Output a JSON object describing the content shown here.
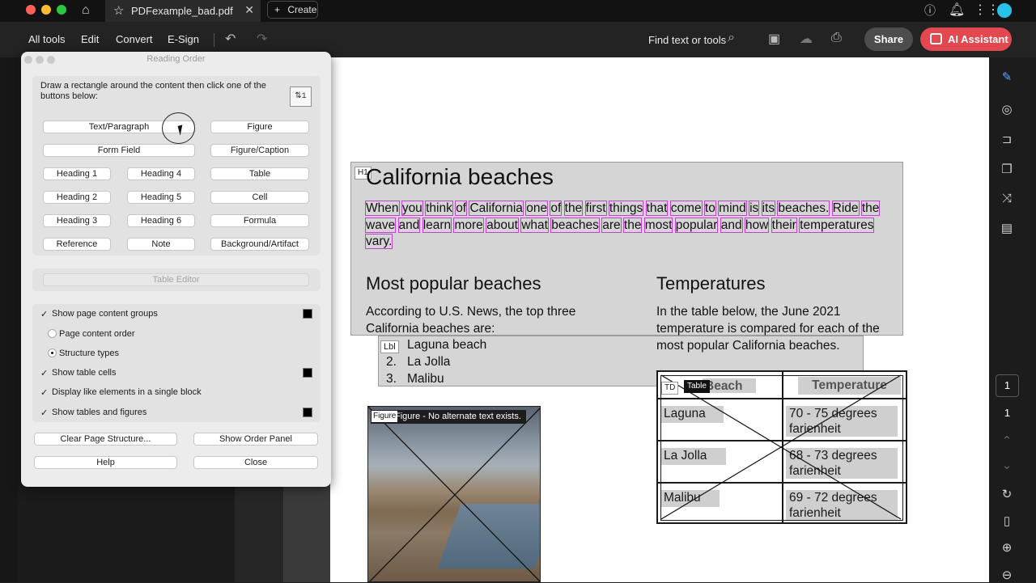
{
  "titlebar": {
    "tab_label": "PDFexample_bad.pdf",
    "create_label": "Create"
  },
  "toolbar": {
    "menus": [
      "All tools",
      "Edit",
      "Convert",
      "E-Sign"
    ],
    "find_label": "Find text or tools",
    "share_label": "Share",
    "ai_label": "AI Assistant"
  },
  "dialog": {
    "title": "Reading Order",
    "instructions": "Draw a rectangle around the content then click one of the buttons below:",
    "buttons": {
      "text_paragraph": "Text/Paragraph",
      "figure": "Figure",
      "form_field": "Form Field",
      "figure_caption": "Figure/Caption",
      "heading1": "Heading 1",
      "heading4": "Heading 4",
      "table": "Table",
      "heading2": "Heading 2",
      "heading5": "Heading 5",
      "cell": "Cell",
      "heading3": "Heading 3",
      "heading6": "Heading 6",
      "formula": "Formula",
      "reference": "Reference",
      "note": "Note",
      "background_artifact": "Background/Artifact",
      "table_editor": "Table Editor",
      "clear_structure": "Clear Page Structure...",
      "show_order_panel": "Show Order Panel",
      "help": "Help",
      "close": "Close"
    },
    "options": {
      "show_groups": "Show page content groups",
      "page_order": "Page content order",
      "structure_types": "Structure types",
      "show_cells": "Show table cells",
      "single_block": "Display like elements in a single block",
      "show_tables": "Show tables and figures"
    }
  },
  "document": {
    "h1_tag": "H1",
    "heading": "California beaches",
    "intro_words": [
      "When",
      "you",
      "think",
      "of",
      "California",
      "one",
      "of",
      "the",
      "first",
      "things",
      "that",
      "come",
      "to",
      "mind",
      "is",
      "its",
      "beaches.",
      "Ride",
      "the",
      "wave",
      "and",
      "learn",
      "more",
      "about",
      "what",
      "beaches",
      "are",
      "the",
      "most",
      "popular",
      "and",
      "how",
      "their",
      "temperatures",
      "vary."
    ],
    "popular_heading": "Most popular beaches",
    "popular_text": "According to U.S. News, the top three California beaches are:",
    "list_tag": "Lbl",
    "list_items": [
      "Laguna beach",
      "La Jolla",
      "Malibu"
    ],
    "list_numbers": [
      "2.",
      "3."
    ],
    "temp_heading": "Temperatures",
    "temp_text": "In the table below, the June 2021 temperature is compared for each of the most popular California beaches.",
    "figure_tag": "Figure",
    "figure_caption": "Figure - No alternate text exists.",
    "table_tags": {
      "td": "TD",
      "table": "Table"
    },
    "table_headers": [
      "Beach",
      "Temperature"
    ],
    "table_rows": [
      [
        "Laguna",
        "70 - 75 degrees farienheit"
      ],
      [
        "La Jolla",
        "68 - 73 degrees farienheit"
      ],
      [
        "Malibu",
        "69 - 72 degrees farienheit"
      ]
    ]
  },
  "rightbar": {
    "page_current": "1",
    "page_total": "1"
  }
}
